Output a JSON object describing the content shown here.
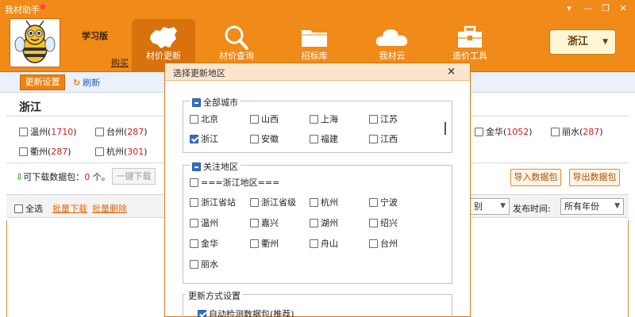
{
  "app": {
    "title": "我材助手",
    "edition": "学习版",
    "buy_link": "购买"
  },
  "window_controls": [
    "▾",
    "—",
    "❐",
    "✕"
  ],
  "nav": [
    {
      "label": "材价更新",
      "icon": "china-map-icon",
      "active": true
    },
    {
      "label": "材价查询",
      "icon": "magnifier-icon",
      "active": false
    },
    {
      "label": "招标库",
      "icon": "folder-icon",
      "active": false
    },
    {
      "label": "我材云",
      "icon": "cloud-icon",
      "active": false
    },
    {
      "label": "造价工具",
      "icon": "toolbox-icon",
      "active": false
    }
  ],
  "region_button": {
    "label": "浙江"
  },
  "toolbar": {
    "update_settings": "更新设置",
    "refresh": "刷新"
  },
  "province": {
    "title": "浙江"
  },
  "cities": [
    {
      "name": "温州",
      "count": "1710"
    },
    {
      "name": "台州",
      "count": "287"
    },
    {
      "name": "衢州",
      "count": "287"
    },
    {
      "name": "杭州",
      "count": "301"
    },
    {
      "name": "金华",
      "count": "1052"
    },
    {
      "name": "丽水",
      "count": "287"
    }
  ],
  "download": {
    "label": "可下载数据包：",
    "count": "0",
    "unit": "个。",
    "one_click": "一键下载"
  },
  "buttons": {
    "import": "导入数据包",
    "export": "导出数据包"
  },
  "filter": {
    "select_all": "全选",
    "batch_download": "批量下载",
    "batch_delete": "批量删除",
    "category_value": "别",
    "publish_time_label": "发布时间:",
    "publish_time_value": "所有年份"
  },
  "dialog": {
    "title": "选择更新地区",
    "all_cities": {
      "legend": "全部城市",
      "options": [
        {
          "label": "北京",
          "checked": false
        },
        {
          "label": "山西",
          "checked": false
        },
        {
          "label": "上海",
          "checked": false
        },
        {
          "label": "江苏",
          "checked": false
        },
        {
          "label": "浙江",
          "checked": true
        },
        {
          "label": "安徽",
          "checked": false
        },
        {
          "label": "福建",
          "checked": false
        },
        {
          "label": "江西",
          "checked": false
        }
      ]
    },
    "focus_regions": {
      "legend": "关注地区",
      "header": "===浙江地区===",
      "options": [
        {
          "label": "浙江省站",
          "checked": false
        },
        {
          "label": "浙江省级",
          "checked": false
        },
        {
          "label": "杭州",
          "checked": false
        },
        {
          "label": "宁波",
          "checked": false
        },
        {
          "label": "温州",
          "checked": false
        },
        {
          "label": "嘉兴",
          "checked": false
        },
        {
          "label": "湖州",
          "checked": false
        },
        {
          "label": "绍兴",
          "checked": false
        },
        {
          "label": "金华",
          "checked": false
        },
        {
          "label": "衢州",
          "checked": false
        },
        {
          "label": "舟山",
          "checked": false
        },
        {
          "label": "台州",
          "checked": false
        },
        {
          "label": "丽水",
          "checked": false
        }
      ]
    },
    "update_mode": {
      "legend": "更新方式设置",
      "auto_detect": {
        "label": "自动检测数据包(推荐)",
        "checked": true
      }
    }
  },
  "colors": {
    "accent": "#f08a18",
    "count_red": "#d11b1b",
    "link_blue": "#1e5bb8"
  }
}
